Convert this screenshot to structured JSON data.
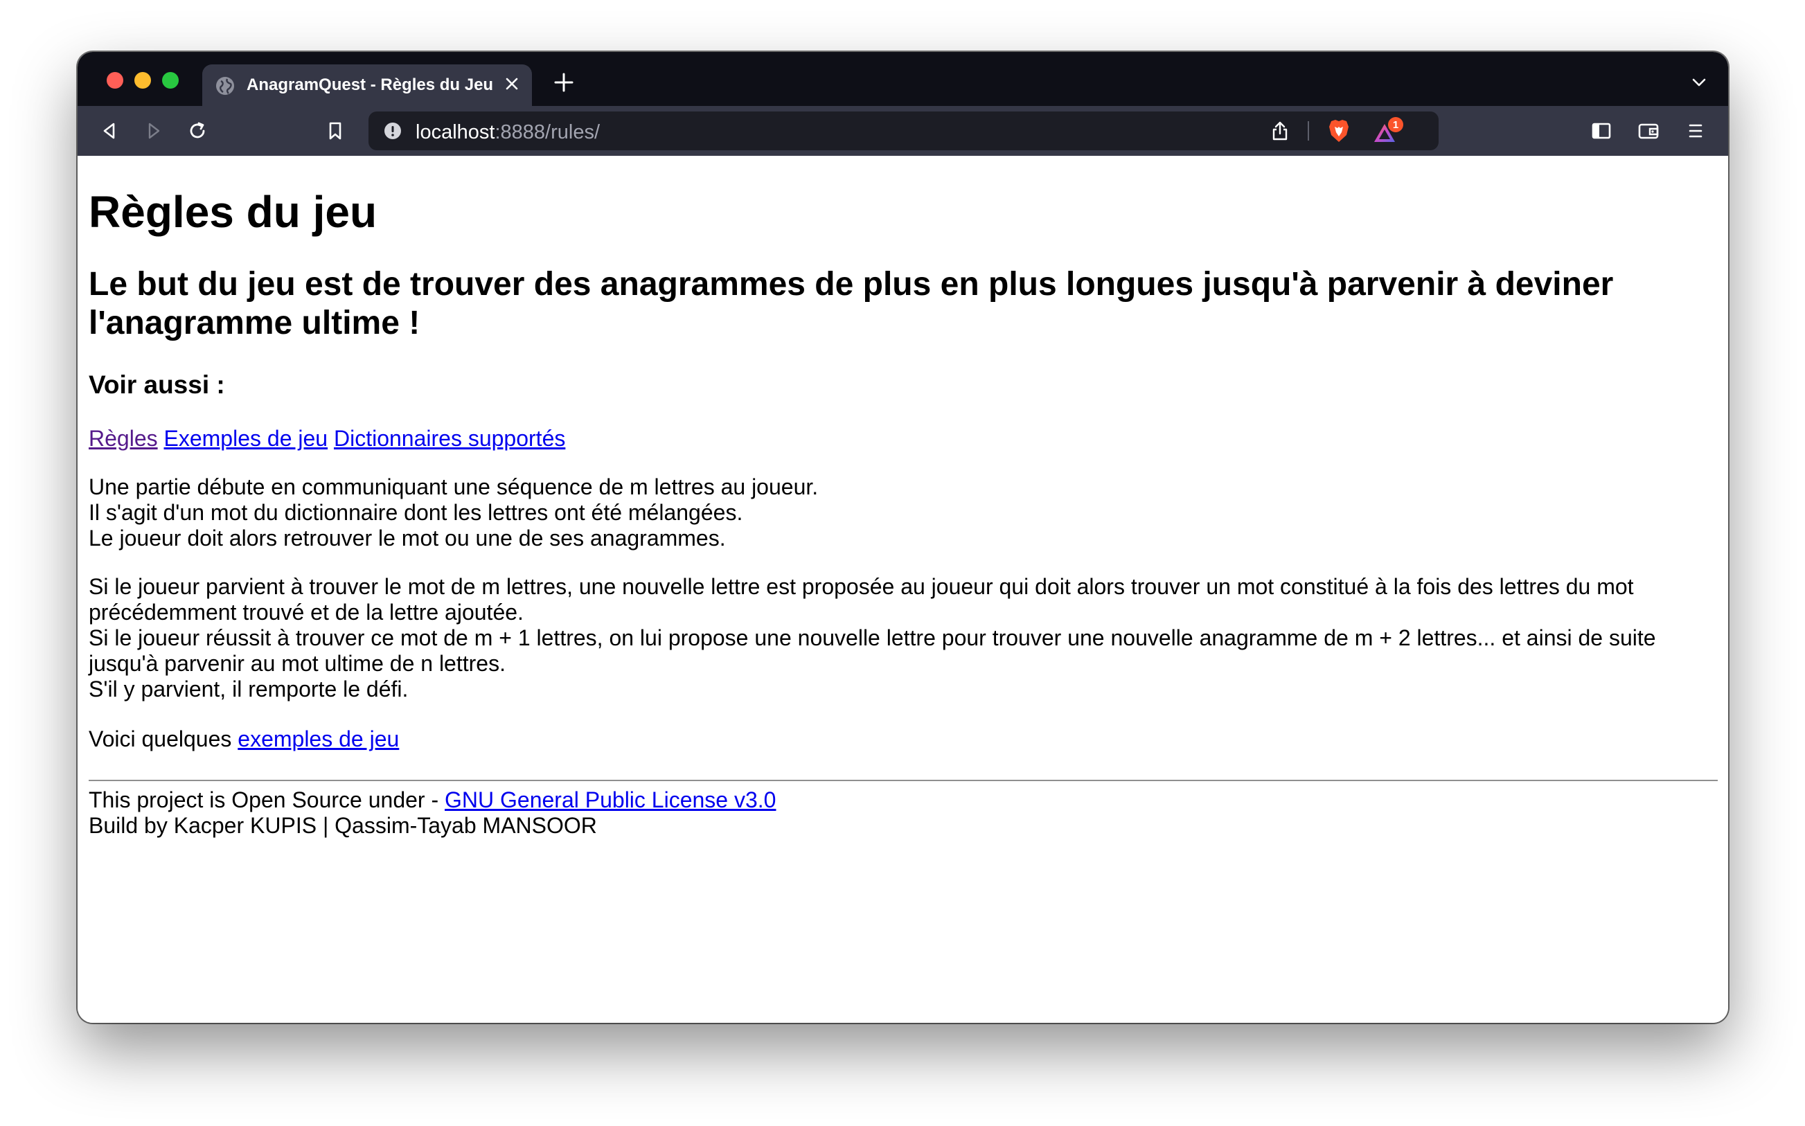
{
  "browser": {
    "tab": {
      "title": "AnagramQuest - Règles du Jeu"
    },
    "address_bar": {
      "host": "localhost",
      "rest": ":8888/rules/"
    },
    "rewards_badge": "1"
  },
  "page": {
    "title": "Règles du jeu",
    "subtitle": "Le but du jeu est de trouver des anagrammes de plus en plus longues jusqu'à parvenir à deviner l'anagramme ultime !",
    "see_also_heading": "Voir aussi :",
    "nav_links": [
      {
        "label": "Règles"
      },
      {
        "label": "Exemples de jeu"
      },
      {
        "label": "Dictionnaires supportés"
      }
    ],
    "paragraph1": [
      "Une partie débute en communiquant une séquence de m lettres au joueur.",
      "Il s'agit d'un mot du dictionnaire dont les lettres ont été mélangées.",
      "Le joueur doit alors retrouver le mot ou une de ses anagrammes."
    ],
    "paragraph2": [
      "Si le joueur parvient à trouver le mot de m lettres, une nouvelle lettre est proposée au joueur qui doit alors trouver un mot constitué à la fois des lettres du mot précédemment trouvé et de la lettre ajoutée.",
      "Si le joueur réussit à trouver ce mot de m + 1 lettres, on lui propose une nouvelle lettre pour trouver une nouvelle anagramme de m + 2 lettres... et ainsi de suite jusqu'à parvenir au mot ultime de n lettres.",
      "S'il y parvient, il remporte le défi."
    ],
    "examples_prefix": "Voici quelques ",
    "examples_link": "exemples de jeu",
    "footer": {
      "license_prefix": "This project is Open Source under - ",
      "license_link": "GNU General Public License v3.0",
      "credits": "Build by Kacper KUPIS | Qassim-Tayab MANSOOR"
    }
  }
}
